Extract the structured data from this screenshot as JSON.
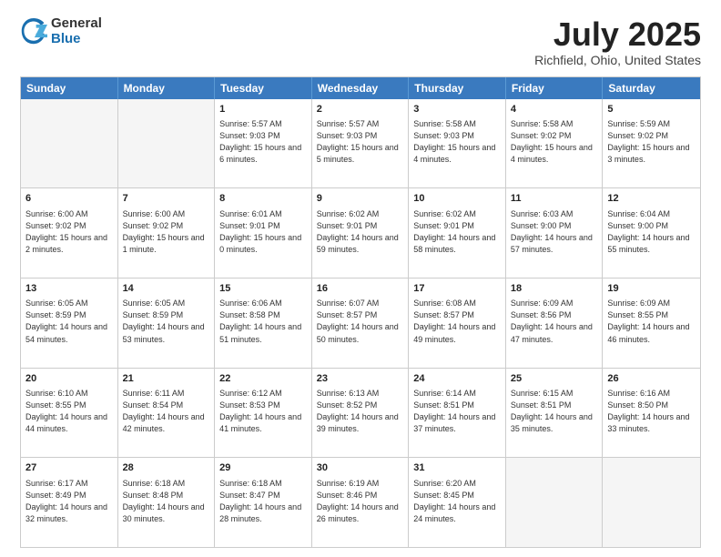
{
  "header": {
    "logo_general": "General",
    "logo_blue": "Blue",
    "month_year": "July 2025",
    "location": "Richfield, Ohio, United States"
  },
  "calendar": {
    "days_of_week": [
      "Sunday",
      "Monday",
      "Tuesday",
      "Wednesday",
      "Thursday",
      "Friday",
      "Saturday"
    ],
    "weeks": [
      [
        {
          "day": "",
          "empty": true
        },
        {
          "day": "",
          "empty": true
        },
        {
          "day": "1",
          "sunrise": "Sunrise: 5:57 AM",
          "sunset": "Sunset: 9:03 PM",
          "daylight": "Daylight: 15 hours and 6 minutes."
        },
        {
          "day": "2",
          "sunrise": "Sunrise: 5:57 AM",
          "sunset": "Sunset: 9:03 PM",
          "daylight": "Daylight: 15 hours and 5 minutes."
        },
        {
          "day": "3",
          "sunrise": "Sunrise: 5:58 AM",
          "sunset": "Sunset: 9:03 PM",
          "daylight": "Daylight: 15 hours and 4 minutes."
        },
        {
          "day": "4",
          "sunrise": "Sunrise: 5:58 AM",
          "sunset": "Sunset: 9:02 PM",
          "daylight": "Daylight: 15 hours and 4 minutes."
        },
        {
          "day": "5",
          "sunrise": "Sunrise: 5:59 AM",
          "sunset": "Sunset: 9:02 PM",
          "daylight": "Daylight: 15 hours and 3 minutes."
        }
      ],
      [
        {
          "day": "6",
          "sunrise": "Sunrise: 6:00 AM",
          "sunset": "Sunset: 9:02 PM",
          "daylight": "Daylight: 15 hours and 2 minutes."
        },
        {
          "day": "7",
          "sunrise": "Sunrise: 6:00 AM",
          "sunset": "Sunset: 9:02 PM",
          "daylight": "Daylight: 15 hours and 1 minute."
        },
        {
          "day": "8",
          "sunrise": "Sunrise: 6:01 AM",
          "sunset": "Sunset: 9:01 PM",
          "daylight": "Daylight: 15 hours and 0 minutes."
        },
        {
          "day": "9",
          "sunrise": "Sunrise: 6:02 AM",
          "sunset": "Sunset: 9:01 PM",
          "daylight": "Daylight: 14 hours and 59 minutes."
        },
        {
          "day": "10",
          "sunrise": "Sunrise: 6:02 AM",
          "sunset": "Sunset: 9:01 PM",
          "daylight": "Daylight: 14 hours and 58 minutes."
        },
        {
          "day": "11",
          "sunrise": "Sunrise: 6:03 AM",
          "sunset": "Sunset: 9:00 PM",
          "daylight": "Daylight: 14 hours and 57 minutes."
        },
        {
          "day": "12",
          "sunrise": "Sunrise: 6:04 AM",
          "sunset": "Sunset: 9:00 PM",
          "daylight": "Daylight: 14 hours and 55 minutes."
        }
      ],
      [
        {
          "day": "13",
          "sunrise": "Sunrise: 6:05 AM",
          "sunset": "Sunset: 8:59 PM",
          "daylight": "Daylight: 14 hours and 54 minutes."
        },
        {
          "day": "14",
          "sunrise": "Sunrise: 6:05 AM",
          "sunset": "Sunset: 8:59 PM",
          "daylight": "Daylight: 14 hours and 53 minutes."
        },
        {
          "day": "15",
          "sunrise": "Sunrise: 6:06 AM",
          "sunset": "Sunset: 8:58 PM",
          "daylight": "Daylight: 14 hours and 51 minutes."
        },
        {
          "day": "16",
          "sunrise": "Sunrise: 6:07 AM",
          "sunset": "Sunset: 8:57 PM",
          "daylight": "Daylight: 14 hours and 50 minutes."
        },
        {
          "day": "17",
          "sunrise": "Sunrise: 6:08 AM",
          "sunset": "Sunset: 8:57 PM",
          "daylight": "Daylight: 14 hours and 49 minutes."
        },
        {
          "day": "18",
          "sunrise": "Sunrise: 6:09 AM",
          "sunset": "Sunset: 8:56 PM",
          "daylight": "Daylight: 14 hours and 47 minutes."
        },
        {
          "day": "19",
          "sunrise": "Sunrise: 6:09 AM",
          "sunset": "Sunset: 8:55 PM",
          "daylight": "Daylight: 14 hours and 46 minutes."
        }
      ],
      [
        {
          "day": "20",
          "sunrise": "Sunrise: 6:10 AM",
          "sunset": "Sunset: 8:55 PM",
          "daylight": "Daylight: 14 hours and 44 minutes."
        },
        {
          "day": "21",
          "sunrise": "Sunrise: 6:11 AM",
          "sunset": "Sunset: 8:54 PM",
          "daylight": "Daylight: 14 hours and 42 minutes."
        },
        {
          "day": "22",
          "sunrise": "Sunrise: 6:12 AM",
          "sunset": "Sunset: 8:53 PM",
          "daylight": "Daylight: 14 hours and 41 minutes."
        },
        {
          "day": "23",
          "sunrise": "Sunrise: 6:13 AM",
          "sunset": "Sunset: 8:52 PM",
          "daylight": "Daylight: 14 hours and 39 minutes."
        },
        {
          "day": "24",
          "sunrise": "Sunrise: 6:14 AM",
          "sunset": "Sunset: 8:51 PM",
          "daylight": "Daylight: 14 hours and 37 minutes."
        },
        {
          "day": "25",
          "sunrise": "Sunrise: 6:15 AM",
          "sunset": "Sunset: 8:51 PM",
          "daylight": "Daylight: 14 hours and 35 minutes."
        },
        {
          "day": "26",
          "sunrise": "Sunrise: 6:16 AM",
          "sunset": "Sunset: 8:50 PM",
          "daylight": "Daylight: 14 hours and 33 minutes."
        }
      ],
      [
        {
          "day": "27",
          "sunrise": "Sunrise: 6:17 AM",
          "sunset": "Sunset: 8:49 PM",
          "daylight": "Daylight: 14 hours and 32 minutes."
        },
        {
          "day": "28",
          "sunrise": "Sunrise: 6:18 AM",
          "sunset": "Sunset: 8:48 PM",
          "daylight": "Daylight: 14 hours and 30 minutes."
        },
        {
          "day": "29",
          "sunrise": "Sunrise: 6:18 AM",
          "sunset": "Sunset: 8:47 PM",
          "daylight": "Daylight: 14 hours and 28 minutes."
        },
        {
          "day": "30",
          "sunrise": "Sunrise: 6:19 AM",
          "sunset": "Sunset: 8:46 PM",
          "daylight": "Daylight: 14 hours and 26 minutes."
        },
        {
          "day": "31",
          "sunrise": "Sunrise: 6:20 AM",
          "sunset": "Sunset: 8:45 PM",
          "daylight": "Daylight: 14 hours and 24 minutes."
        },
        {
          "day": "",
          "empty": true
        },
        {
          "day": "",
          "empty": true
        }
      ]
    ]
  }
}
